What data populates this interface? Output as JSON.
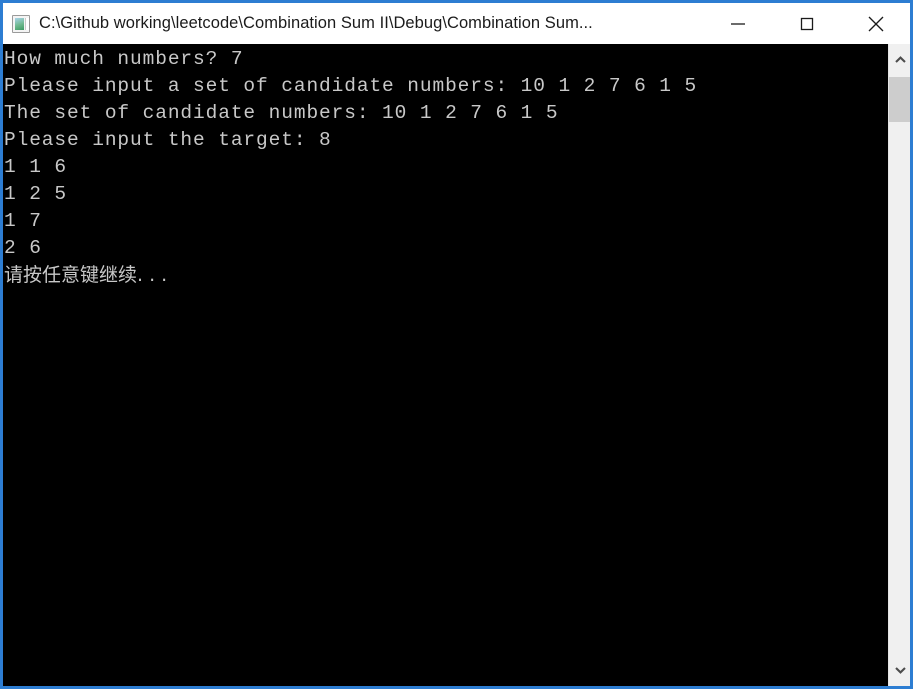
{
  "window": {
    "title": "C:\\Github working\\leetcode\\Combination Sum II\\Debug\\Combination Sum...",
    "icon": "console-app-icon",
    "border_color": "#2d7dd2",
    "titlebar_background": "#ffffff",
    "console_background": "#000000",
    "console_text_color": "#c8c8c8"
  },
  "window_controls": {
    "minimize_label": "—",
    "minimize_name": "minimize-icon",
    "maximize_label": "□",
    "maximize_name": "maximize-icon",
    "close_label": "✕",
    "close_name": "close-icon"
  },
  "console": {
    "lines": [
      "How much numbers? 7",
      "Please input a set of candidate numbers: 10 1 2 7 6 1 5",
      "The set of candidate numbers: 10 1 2 7 6 1 5",
      "Please input the target: 8",
      "1 1 6",
      "1 2 5",
      "1 7",
      "2 6",
      "请按任意键继续. . ."
    ],
    "cjk_line_index": 8
  },
  "scrollbar": {
    "up_arrow": "chevron-up-icon",
    "down_arrow": "chevron-down-icon",
    "thumb_color": "#cdcdcd",
    "track_color": "#f0f0f0"
  }
}
